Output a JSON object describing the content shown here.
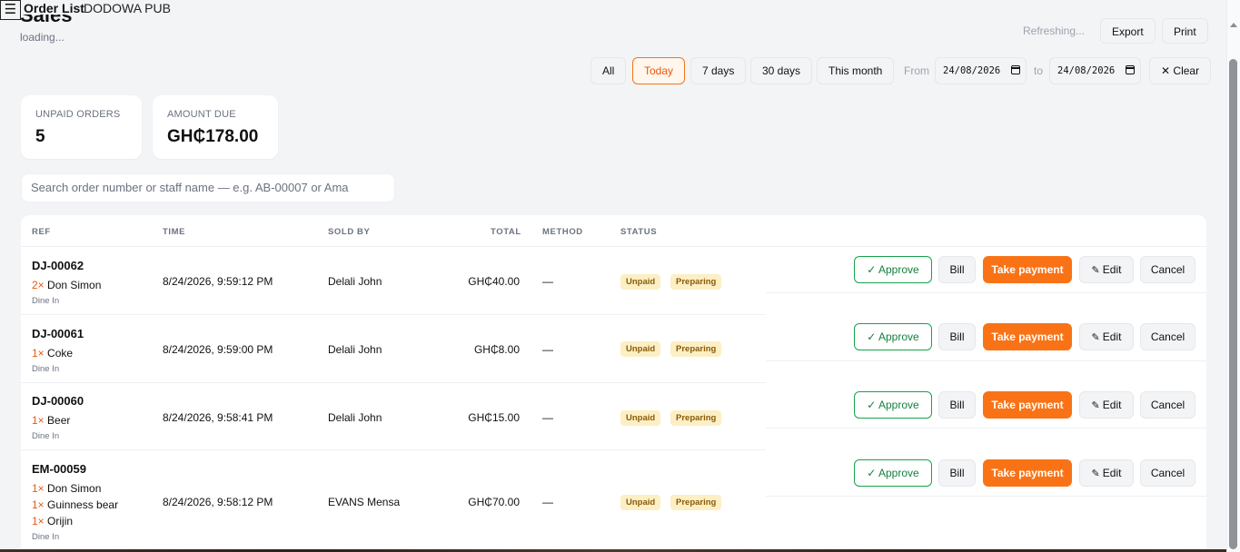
{
  "topbar": {
    "menu_icon": "☰",
    "title": "Order List",
    "store": "DODOWA PUB"
  },
  "page": {
    "heading": "Sales",
    "loading": "loading..."
  },
  "header": {
    "refreshing": "Refreshing...",
    "export": "Export",
    "print": "Print"
  },
  "filters": {
    "all": "All",
    "today": "Today",
    "seven_days": "7 days",
    "thirty_days": "30 days",
    "this_month": "This month",
    "from_label": "From",
    "from_date": "24/08/2026",
    "to_label": "to",
    "to_date": "24/08/2026",
    "clear": "Clear",
    "clear_icon": "✕",
    "active": "Today"
  },
  "stats": {
    "unpaid_label": "UNPAID ORDERS",
    "unpaid_value": "5",
    "amount_label": "AMOUNT DUE",
    "amount_value": "GH₵178.00"
  },
  "search": {
    "placeholder": "Search order number or staff name — e.g. AB-00007 or Ama"
  },
  "table": {
    "headers": {
      "ref": "REF",
      "time": "TIME",
      "sold_by": "SOLD BY",
      "total": "TOTAL",
      "method": "METHOD",
      "status": "STATUS"
    },
    "actions": {
      "approve": "✓ Approve",
      "bill": "Bill",
      "take_payment": "Take payment",
      "edit": "Edit",
      "edit_icon": "✎",
      "cancel": "Cancel"
    },
    "rows": [
      {
        "ref": "DJ-00062",
        "items": [
          {
            "qty": "2×",
            "name": "Don Simon"
          }
        ],
        "type": "Dine In",
        "time": "8/24/2026, 9:59:12 PM",
        "sold_by": "Delali John",
        "total": "GH₵40.00",
        "method": "—",
        "payment_status": "Unpaid",
        "order_status": "Preparing"
      },
      {
        "ref": "DJ-00061",
        "items": [
          {
            "qty": "1×",
            "name": "Coke"
          }
        ],
        "type": "Dine In",
        "time": "8/24/2026, 9:59:00 PM",
        "sold_by": "Delali John",
        "total": "GH₵8.00",
        "method": "—",
        "payment_status": "Unpaid",
        "order_status": "Preparing"
      },
      {
        "ref": "DJ-00060",
        "items": [
          {
            "qty": "1×",
            "name": "Beer"
          }
        ],
        "type": "Dine In",
        "time": "8/24/2026, 9:58:41 PM",
        "sold_by": "Delali John",
        "total": "GH₵15.00",
        "method": "—",
        "payment_status": "Unpaid",
        "order_status": "Preparing"
      },
      {
        "ref": "EM-00059",
        "items": [
          {
            "qty": "1×",
            "name": "Don Simon"
          },
          {
            "qty": "1×",
            "name": "Guinness bear"
          },
          {
            "qty": "1×",
            "name": "Orijin"
          }
        ],
        "type": "Dine In",
        "time": "8/24/2026, 9:58:12 PM",
        "sold_by": "EVANS Mensa",
        "total": "GH₵70.00",
        "method": "—",
        "payment_status": "Unpaid",
        "order_status": "Preparing"
      }
    ]
  },
  "colors": {
    "accent": "#f97316",
    "approve": "#16a34a",
    "badge_bg": "#fdefc4"
  }
}
